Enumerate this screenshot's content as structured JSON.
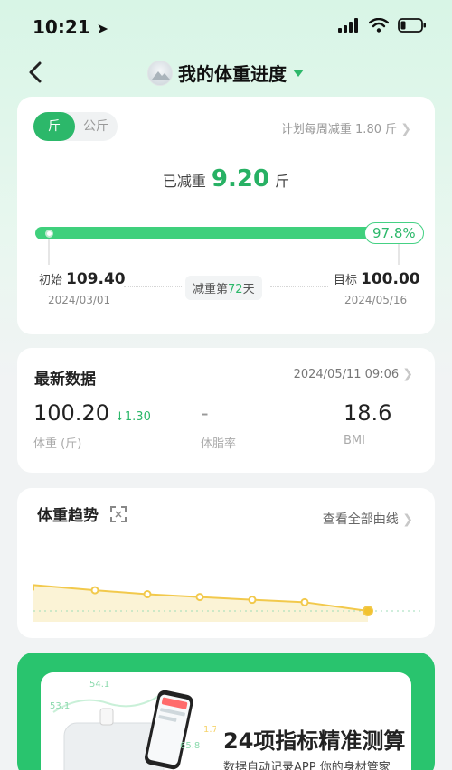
{
  "status_bar": {
    "time": "10:21"
  },
  "nav": {
    "title": "我的体重进度"
  },
  "progress_card": {
    "units": [
      "斤",
      "公斤"
    ],
    "active_unit": "斤",
    "plan_text": "计划每周减重 1.80 斤",
    "lost_prefix": "已减重",
    "lost_value": "9.20",
    "lost_unit": "斤",
    "progress_percent": 97.8,
    "progress_label": "97.8%",
    "start_label": "初始",
    "start_value": "109.40",
    "start_date": "2024/03/01",
    "days_prefix": "减重第",
    "days_value": "72",
    "days_suffix": "天",
    "goal_label": "目标",
    "goal_value": "100.00",
    "goal_date": "2024/05/16"
  },
  "latest_card": {
    "title": "最新数据",
    "datetime": "2024/05/11 09:06",
    "weight_value": "100.20",
    "weight_delta": "1.30",
    "weight_label": "体重 (斤)",
    "bodyfat_value": "-",
    "bodyfat_label": "体脂率",
    "bmi_value": "18.6",
    "bmi_label": "BMI"
  },
  "trend_card": {
    "title": "体重趋势",
    "link": "查看全部曲线",
    "points": [
      0.35,
      0.48,
      0.58,
      0.65,
      0.72,
      0.78,
      1.0
    ],
    "line_color": "#f2c94c",
    "area_color": "#fbf3d6"
  },
  "promo": {
    "title": "24项指标精准测算",
    "subtitle": "数据自动记录APP 你的身材管家",
    "deco_numbers": [
      "53.1",
      "54.1",
      "65.8",
      "1.7"
    ]
  }
}
